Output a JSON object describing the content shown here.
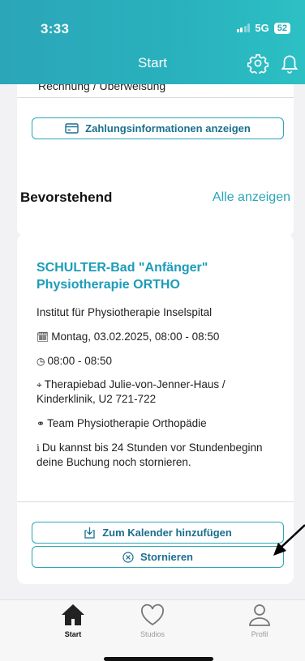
{
  "status_bar": {
    "time": "3:33",
    "network": "5G",
    "battery": "52"
  },
  "header": {
    "title": "Start",
    "settings_icon": "gear-icon",
    "notifications_icon": "bell-icon"
  },
  "payment_card": {
    "method": "Rechnung / Überweisung",
    "button_label": "Zahlungsinformationen anzeigen",
    "button_icon": "credit-card-icon"
  },
  "upcoming": {
    "title": "Bevorstehend",
    "show_all": "Alle anzeigen",
    "event": {
      "title": "SCHULTER-Bad \"Anfänger\" Physiotherapie ORTHO",
      "institute": "Institut für Physiotherapie Inselspital",
      "date": "Montag, 03.02.2025, 08:00 - 08:50",
      "time": "08:00 - 08:50",
      "location": "Therapiebad Julie-von-Jenner-Haus / Kinderklinik, U2 721-722",
      "team": "Team Physiotherapie Orthopädie",
      "info": "Du kannst bis 24 Stunden vor Stundenbeginn deine Buchung noch stornieren.",
      "add_calendar_label": "Zum Kalender hinzufügen",
      "cancel_label": "Stornieren"
    }
  },
  "tabbar": {
    "items": [
      {
        "label": "Start",
        "icon": "home-icon",
        "active": true
      },
      {
        "label": "Studios",
        "icon": "heart-icon",
        "active": false
      },
      {
        "label": "Profil",
        "icon": "person-icon",
        "active": false
      }
    ]
  },
  "colors": {
    "accent": "#2aa6b8",
    "accent_dark": "#1a6f8e",
    "event_title": "#1c9cba"
  }
}
